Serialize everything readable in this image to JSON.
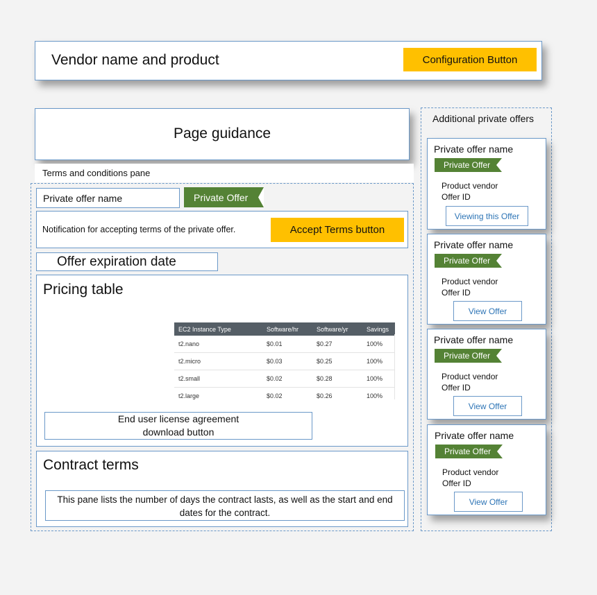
{
  "header": {
    "title": "Vendor name and product",
    "config_button": "Configuration Button"
  },
  "page_guidance": "Page guidance",
  "terms_pane_label": "Terms and conditions pane",
  "offer": {
    "name": "Private offer name",
    "badge": "Private Offer",
    "notification": "Notification for accepting terms of the private offer.",
    "accept_button": "Accept Terms button",
    "expiration": "Offer expiration date"
  },
  "pricing": {
    "title": "Pricing table",
    "columns": [
      "EC2 Instance Type",
      "Software/hr",
      "Software/yr",
      "Savings"
    ],
    "rows": [
      [
        "t2.nano",
        "$0.01",
        "$0.27",
        "100%"
      ],
      [
        "t2.micro",
        "$0.03",
        "$0.25",
        "100%"
      ],
      [
        "t2.small",
        "$0.02",
        "$0.28",
        "100%"
      ],
      [
        "t2.large",
        "$0.02",
        "$0.26",
        "100%"
      ]
    ],
    "eula_line1": "End user license agreement",
    "eula_line2": "download button"
  },
  "contract": {
    "title": "Contract terms",
    "description": "This pane lists the number of days the contract lasts, as well as the start and end dates for the contract."
  },
  "sidebar": {
    "title": "Additional private offers",
    "cards": [
      {
        "name": "Private offer name",
        "badge": "Private Offer",
        "vendor": "Product vendor",
        "offer_id": "Offer ID",
        "button": "Viewing this Offer"
      },
      {
        "name": "Private offer name",
        "badge": "Private Offer",
        "vendor": "Product vendor",
        "offer_id": "Offer ID",
        "button": "View Offer"
      },
      {
        "name": "Private offer name",
        "badge": "Private Offer",
        "vendor": "Product vendor",
        "offer_id": "Offer ID",
        "button": "View Offer"
      },
      {
        "name": "Private offer name",
        "badge": "Private Offer",
        "vendor": "Product vendor",
        "offer_id": "Offer ID",
        "button": "View Offer"
      }
    ]
  },
  "colors": {
    "accent_yellow": "#ffc000",
    "badge_green": "#548235",
    "border_blue": "#6a98c8",
    "link_blue": "#2e75b6",
    "table_header": "#555e66"
  }
}
